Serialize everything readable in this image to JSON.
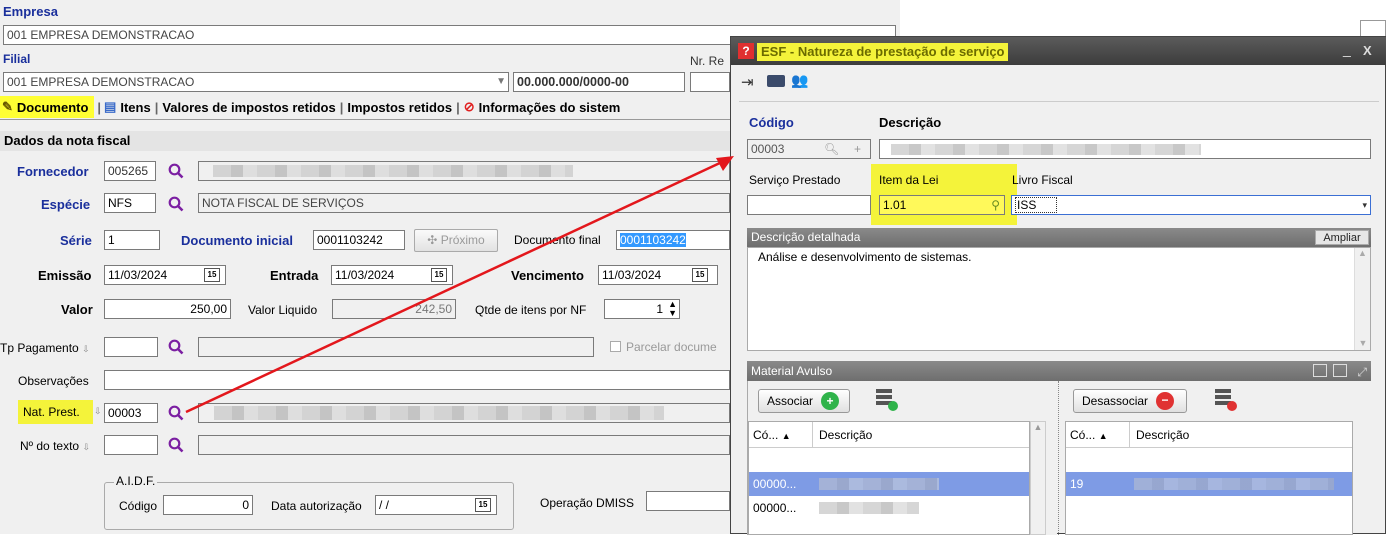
{
  "main": {
    "empresa_label": "Empresa",
    "empresa_value": "001 EMPRESA DEMONSTRACAO",
    "filial_label": "Filial",
    "filial_value": "001 EMPRESA DEMONSTRACAO",
    "cnpj_value": "00.000.000/0000-00",
    "nr_label": "Nr. Re",
    "tabs": [
      {
        "label": "Documento"
      },
      {
        "label": "Itens"
      },
      {
        "label": "Valores de impostos retidos"
      },
      {
        "label": "Impostos retidos"
      },
      {
        "label": "Informações do sistem"
      }
    ],
    "section_title": "Dados da nota fiscal",
    "fornecedor_label": "Fornecedor",
    "fornecedor_code": "005265",
    "especie_label": "Espécie",
    "especie_code": "NFS",
    "especie_desc": "NOTA FISCAL DE SERVIÇOS",
    "serie_label": "Série",
    "serie_value": "1",
    "doc_inicial_label": "Documento inicial",
    "doc_inicial_value": "0001103242",
    "proximo_label": "Próximo",
    "doc_final_label": "Documento final",
    "doc_final_value": "0001103242",
    "emissao_label": "Emissão",
    "emissao_value": "11/03/2024",
    "entrada_label": "Entrada",
    "entrada_value": "11/03/2024",
    "vencimento_label": "Vencimento",
    "vencimento_value": "11/03/2024",
    "valor_label": "Valor",
    "valor_value": "250,00",
    "valor_liquido_label": "Valor Liquido",
    "valor_liquido_value": "242,50",
    "qtde_label": "Qtde de itens por NF",
    "qtde_value": "1",
    "tp_pagamento_label": "Tp Pagamento",
    "parcelar_label": "Parcelar docume",
    "observacoes_label": "Observações",
    "nat_prest_label": "Nat. Prest.",
    "nat_prest_value": "00003",
    "nr_texto_label": "Nº do texto",
    "aidf_title": "A.I.D.F.",
    "aidf_codigo_label": "Código",
    "aidf_codigo_value": "0",
    "data_autorizacao_label": "Data autorização",
    "data_autorizacao_value": " / /",
    "operacao_dmiss_label": "Operação DMISS",
    "calendar_glyph": "15"
  },
  "dialog": {
    "title": "ESF - Natureza de prestação de serviço",
    "codigo_label": "Código",
    "codigo_value": "00003",
    "descricao_label": "Descrição",
    "servico_prestado_label": "Serviço Prestado",
    "item_lei_label": "Item da Lei",
    "item_lei_value": "1.01",
    "livro_fiscal_label": "Livro Fiscal",
    "livro_fiscal_value": "ISS",
    "descricao_detalhada_label": "Descrição detalhada",
    "ampliar_label": "Ampliar",
    "descricao_detalhada_value": "Análise e desenvolvimento de sistemas.",
    "material_avulso_label": "Material Avulso",
    "associar_label": "Associar",
    "desassociar_label": "Desassociar",
    "left_cols": [
      "Có...",
      "Descrição"
    ],
    "right_cols": [
      "Có...",
      "Descrição"
    ],
    "left_rows": [
      {
        "code": "00000..."
      },
      {
        "code": "00000..."
      }
    ],
    "right_rows": [
      {
        "code": "19"
      }
    ],
    "minimize_glyph": "_",
    "close_glyph": "X"
  },
  "colors": {
    "label_blue": "#1a2f9c",
    "highlight_yellow": "#f4f33a",
    "magnifier_purple": "#7b1fa2",
    "arrow_red": "#e3171c",
    "dialog_title_bg": "#4a4a4a",
    "selected_row_blue": "#7e9be5"
  },
  "icons": [
    "search-icon",
    "pencil-icon",
    "edit-list-icon",
    "forbidden-icon",
    "calendar-icon",
    "add-icon",
    "remove-icon",
    "close-icon",
    "minimize-icon",
    "app-logo-icon",
    "export-icon",
    "card-icon",
    "users-icon"
  ]
}
